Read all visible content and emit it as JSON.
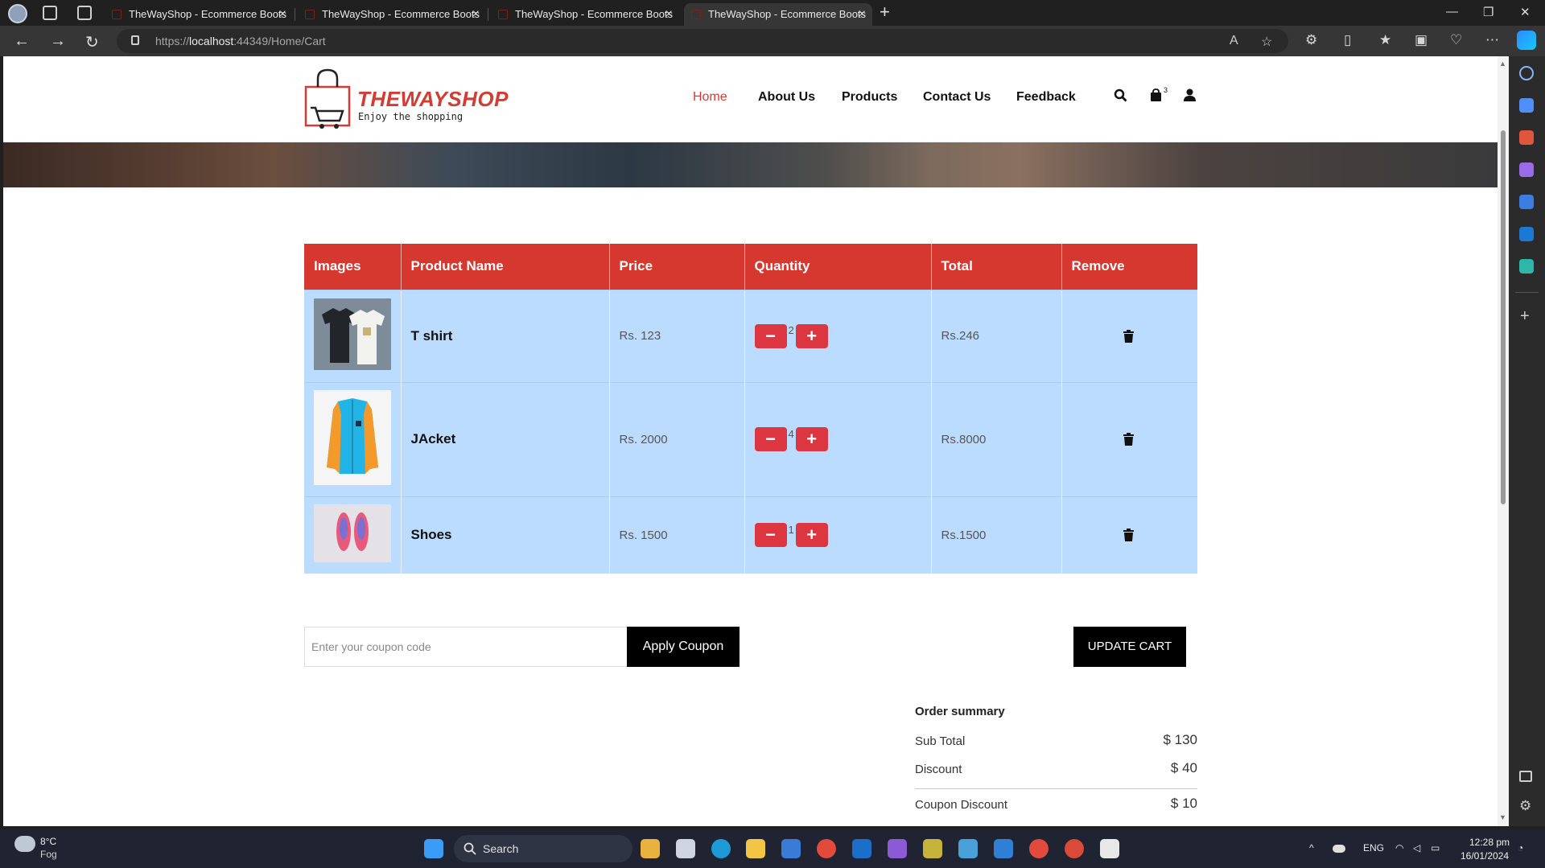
{
  "browser": {
    "tabs": [
      {
        "title": "TheWayShop - Ecommerce Boots"
      },
      {
        "title": "TheWayShop - Ecommerce Boots"
      },
      {
        "title": "TheWayShop - Ecommerce Boots"
      },
      {
        "title": "TheWayShop - Ecommerce Boots"
      }
    ],
    "url_prefix": "https://",
    "url_host": "localhost",
    "url_rest": ":44349/Home/Cart"
  },
  "site": {
    "logo_title": "THEWAYSHOP",
    "logo_tagline": "Enjoy the shopping",
    "nav": [
      "Home",
      "About Us",
      "Products",
      "Contact Us",
      "Feedback"
    ],
    "cart_count": "3",
    "accent_color": "#d6382f"
  },
  "cart": {
    "headers": [
      "Images",
      "Product Name",
      "Price",
      "Quantity",
      "Total",
      "Remove"
    ],
    "rows": [
      {
        "name": "T shirt",
        "price": "Rs. 123",
        "qty": "2",
        "total": "Rs.246"
      },
      {
        "name": "JAcket",
        "price": "Rs. 2000",
        "qty": "4",
        "total": "Rs.8000"
      },
      {
        "name": "Shoes",
        "price": "Rs. 1500",
        "qty": "1",
        "total": "Rs.1500"
      }
    ]
  },
  "coupon": {
    "placeholder": "Enter your coupon code",
    "apply_label": "Apply Coupon",
    "update_label": "UPDATE CART"
  },
  "summary": {
    "title": "Order summary",
    "sub_total_label": "Sub Total",
    "sub_total_value": "$ 130",
    "discount_label": "Discount",
    "discount_value": "$ 40",
    "coupon_discount_label": "Coupon Discount",
    "coupon_discount_value": "$ 10"
  },
  "taskbar": {
    "temperature": "8°C",
    "weather": "Fog",
    "search_label": "Search",
    "language": "ENG",
    "time": "12:28 pm",
    "date": "16/01/2024"
  }
}
